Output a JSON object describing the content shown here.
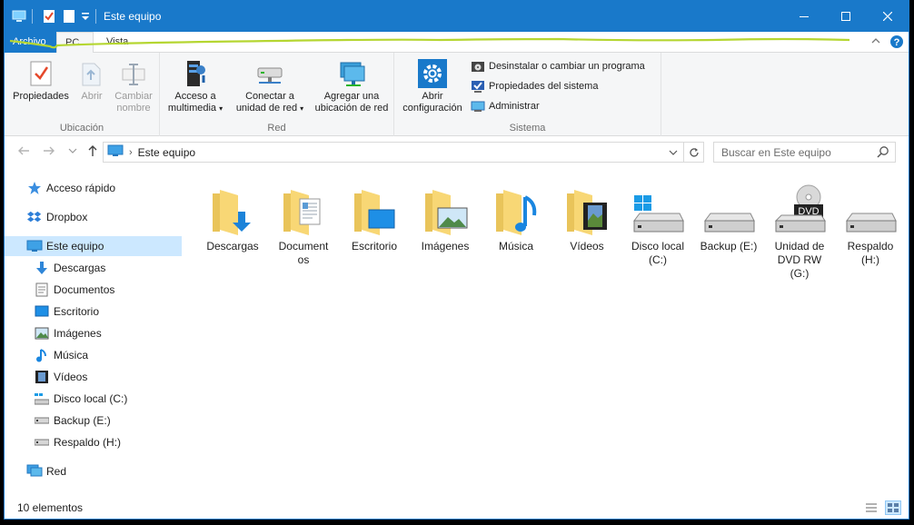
{
  "window": {
    "title": "Este equipo"
  },
  "title_controls": {
    "minimize": "—",
    "maximize": "□",
    "close": "✕"
  },
  "tabs": [
    {
      "label": "Archivo"
    },
    {
      "label": "PC"
    },
    {
      "label": "Vista"
    }
  ],
  "ribbon": {
    "ubicacion": {
      "label": "Ubicación",
      "propiedades": "Propiedades",
      "abrir": "Abrir",
      "cambiar_nombre_1": "Cambiar",
      "cambiar_nombre_2": "nombre"
    },
    "red": {
      "label": "Red",
      "acceso_1": "Acceso a",
      "acceso_2": "multimedia",
      "conectar_1": "Conectar a",
      "conectar_2": "unidad de red",
      "agregar_1": "Agregar una",
      "agregar_2": "ubicación de red"
    },
    "sistema": {
      "label": "Sistema",
      "abrir_1": "Abrir",
      "abrir_2": "configuración",
      "desinstalar": "Desinstalar o cambiar un programa",
      "propiedades_sistema": "Propiedades del sistema",
      "administrar": "Administrar"
    }
  },
  "address": {
    "crumb": "Este equipo",
    "search_placeholder": "Buscar en Este equipo"
  },
  "sidebar": {
    "items": [
      {
        "label": "Acceso rápido",
        "icon": "star-icon"
      },
      {
        "label": "Dropbox",
        "icon": "dropbox-icon"
      },
      {
        "label": "Este equipo",
        "icon": "computer-icon"
      },
      {
        "label": "Descargas",
        "icon": "download-icon"
      },
      {
        "label": "Documentos",
        "icon": "document-icon"
      },
      {
        "label": "Escritorio",
        "icon": "desktop-icon"
      },
      {
        "label": "Imágenes",
        "icon": "picture-icon"
      },
      {
        "label": "Música",
        "icon": "music-icon"
      },
      {
        "label": "Vídeos",
        "icon": "video-icon"
      },
      {
        "label": "Disco local (C:)",
        "icon": "windows-drive-icon"
      },
      {
        "label": "Backup (E:)",
        "icon": "drive-icon"
      },
      {
        "label": "Respaldo (H:)",
        "icon": "drive-icon"
      },
      {
        "label": "Red",
        "icon": "network-icon"
      }
    ]
  },
  "items": [
    {
      "line1": "Descargas",
      "line2": "",
      "line3": "",
      "icon": "downloads-folder-icon"
    },
    {
      "line1": "Document",
      "line2": "os",
      "line3": "",
      "icon": "documents-folder-icon"
    },
    {
      "line1": "Escritorio",
      "line2": "",
      "line3": "",
      "icon": "desktop-folder-icon"
    },
    {
      "line1": "Imágenes",
      "line2": "",
      "line3": "",
      "icon": "pictures-folder-icon"
    },
    {
      "line1": "Música",
      "line2": "",
      "line3": "",
      "icon": "music-folder-icon"
    },
    {
      "line1": "Vídeos",
      "line2": "",
      "line3": "",
      "icon": "videos-folder-icon"
    },
    {
      "line1": "Disco local",
      "line2": "(C:)",
      "line3": "",
      "icon": "windows-drive-icon"
    },
    {
      "line1": "Backup (E:)",
      "line2": "",
      "line3": "",
      "icon": "drive-icon"
    },
    {
      "line1": "Unidad de",
      "line2": "DVD RW",
      "line3": "(G:)",
      "icon": "dvd-drive-icon",
      "badge": "DVD"
    },
    {
      "line1": "Respaldo",
      "line2": "(H:)",
      "line3": "",
      "icon": "drive-icon"
    }
  ],
  "status": {
    "count": "10 elementos"
  },
  "colors": {
    "accent": "#1979ca",
    "selected": "#cce8ff",
    "folder": "#f8d775",
    "annotation": "#b5d631"
  }
}
